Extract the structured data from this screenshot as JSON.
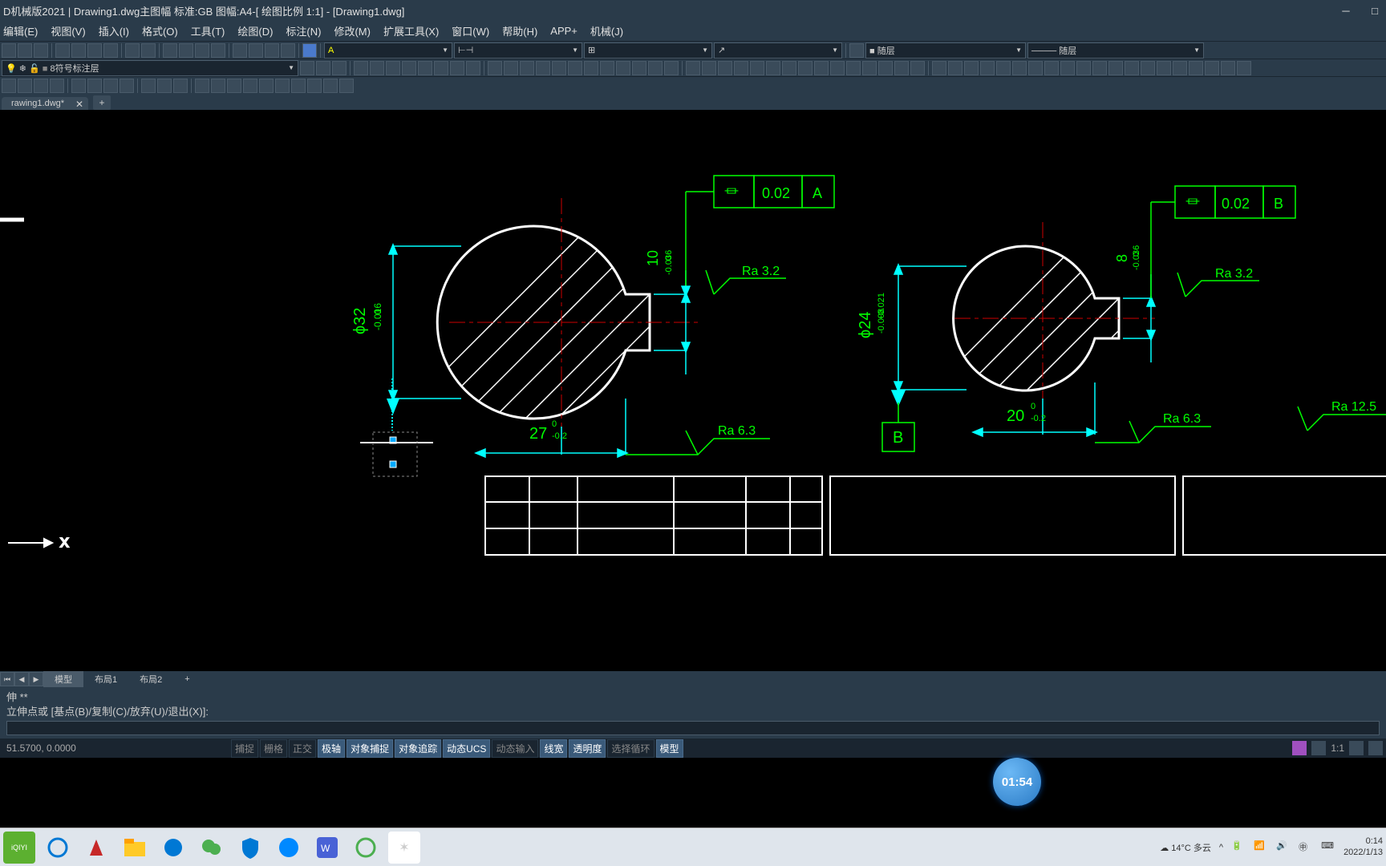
{
  "app": {
    "title": "D机械版2021 | Drawing1.dwg主图幅 标准:GB 图幅:A4-[ 绘图比例 1:1] - [Drawing1.dwg]"
  },
  "menus": [
    "编辑(E)",
    "视图(V)",
    "插入(I)",
    "格式(O)",
    "工具(T)",
    "绘图(D)",
    "标注(N)",
    "修改(M)",
    "扩展工具(X)",
    "窗口(W)",
    "帮助(H)",
    "APP+",
    "机械(J)"
  ],
  "layer_dropdown": "8符号标注层",
  "layer_group_dropdown": "随层",
  "linetype_dropdown": "随层",
  "doc_tab": {
    "name": "rawing1.dwg*",
    "close": "✕",
    "plus": "+"
  },
  "drawing": {
    "tol_frame_a": {
      "sym": "⏛",
      "val": "0.02",
      "ref": "A"
    },
    "tol_frame_b": {
      "sym": "⏛",
      "val": "0.02",
      "ref": "B"
    },
    "dim_diam_left": "ϕ32",
    "dim_tol_left_up": "0",
    "dim_tol_left_low": "-0.016",
    "dim_27": "27",
    "dim_27_up": "0",
    "dim_27_low": "-0.2",
    "dim_10": "10",
    "dim_10_up": "0",
    "dim_10_low": "-0.036",
    "ra32_1": "Ra 3.2",
    "ra63_1": "Ra 6.3",
    "dim_diam_right": "ϕ24",
    "dim_tol_right_up": "+0.021",
    "dim_tol_right_low": "-0.008",
    "dim_8": "8",
    "dim_8_up": "0",
    "dim_8_low": "-0.036",
    "dim_20": "20",
    "dim_20_up": "0",
    "dim_20_low": "-0.2",
    "datum_b": "B",
    "ra32_2": "Ra 3.2",
    "ra63_2": "Ra 6.3",
    "ra125": "Ra 12.5",
    "ucs_x": "X"
  },
  "layout_tabs": {
    "model": "模型",
    "l1": "布局1",
    "l2": "布局2",
    "plus": "+"
  },
  "command": {
    "line1": "伸 **",
    "line2": "立伸点或 [基点(B)/复制(C)/放弃(U)/退出(X)]:"
  },
  "status": {
    "coords": "51.5700, 0.0000",
    "snap": "捕捉",
    "grid": "栅格",
    "ortho": "正交",
    "polar": "极轴",
    "osnap": "对象捕捉",
    "otrack": "对象追踪",
    "ducs": "动态UCS",
    "dyn": "动态输入",
    "lwt": "线宽",
    "trn": "透明度",
    "cycle": "选择循环",
    "model": "模型",
    "ratio": "1:1"
  },
  "timer": "01:54",
  "taskbar": {
    "weather": "14°C 多云",
    "time": "0:14",
    "date": "2022/1/13"
  }
}
